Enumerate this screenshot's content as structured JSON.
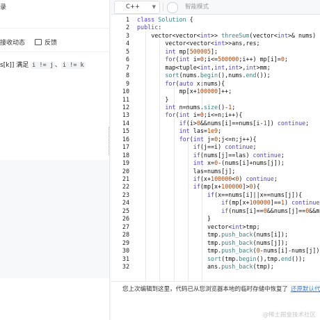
{
  "left_panel": {
    "title_fragment": "录",
    "tab_fragment": "接收动态",
    "feedback_label": "反馈",
    "statement_prefix": "s[k]] 满足",
    "statement_code1": "i != j",
    "statement_sep": "、",
    "statement_code2": "i != k"
  },
  "toolbar": {
    "language": "C++",
    "smart_mode_label": "智能模式"
  },
  "editor": {
    "lines": [
      {
        "n": "1",
        "indent": 0,
        "html": "<span class=\"kw\">class</span> <span class=\"ty\">Solution</span> {"
      },
      {
        "n": "2",
        "indent": 0,
        "html": "<span class=\"kw\">public</span>:"
      },
      {
        "n": "3",
        "indent": 1,
        "html": "vector&lt;vector&lt;<span class=\"kw\">int</span>&gt;&gt; <span class=\"fn\">threeSum</span>(vector&lt;<span class=\"kw\">int</span>&gt;&amp; nums)"
      },
      {
        "n": "4",
        "indent": 2,
        "html": "vector&lt;vector&lt;<span class=\"kw\">int</span>&gt;&gt;ans,res;"
      },
      {
        "n": "5",
        "indent": 2,
        "html": "<span class=\"kw\">int</span> mp[<span class=\"str\">500005</span>];"
      },
      {
        "n": "6",
        "indent": 2,
        "html": "<span class=\"kw\">for</span>(<span class=\"kw\">int</span> i=<span class=\"str\">0</span>;i&lt;=<span class=\"str\">500000</span>;i++) mp[i]=<span class=\"str\">0</span>;"
      },
      {
        "n": "7",
        "indent": 2,
        "html": "map&lt;tuple&lt;<span class=\"kw\">int</span>,<span class=\"kw\">int</span>,<span class=\"kw\">int</span>&gt;,<span class=\"kw\">int</span>&gt;mm;"
      },
      {
        "n": "8",
        "indent": 2,
        "html": "<span class=\"fn\">sort</span>(nums.<span class=\"fn\">begin</span>(),nums.<span class=\"fn\">end</span>());"
      },
      {
        "n": "9",
        "indent": 2,
        "html": "<span class=\"kw\">for</span>(<span class=\"kw\">auto</span> x:nums){"
      },
      {
        "n": "10",
        "indent": 3,
        "html": "mp[x+<span class=\"str\">100000</span>]++;"
      },
      {
        "n": "11",
        "indent": 2,
        "html": "}"
      },
      {
        "n": "12",
        "indent": 2,
        "html": "<span class=\"kw\">int</span> n=nums.<span class=\"fn\">size</span>()-<span class=\"str\">1</span>;"
      },
      {
        "n": "13",
        "indent": 2,
        "html": "<span class=\"kw\">for</span>(<span class=\"kw\">int</span> i=<span class=\"str\">0</span>;i&lt;=n;i++){"
      },
      {
        "n": "14",
        "indent": 3,
        "html": "<span class=\"kw\">if</span>(i&gt;<span class=\"str\">0</span>&amp;&amp;nums[i]==nums[i-<span class=\"str\">1</span>]) <span class=\"kw\">continue</span>;"
      },
      {
        "n": "15",
        "indent": 3,
        "html": "<span class=\"kw\">int</span> las=<span class=\"str\">1e9</span>;"
      },
      {
        "n": "16",
        "indent": 3,
        "html": "<span class=\"kw\">for</span>(<span class=\"kw\">int</span> j=<span class=\"str\">0</span>;j&lt;=n;j++){"
      },
      {
        "n": "17",
        "indent": 4,
        "html": "<span class=\"kw\">if</span>(j==i) <span class=\"kw\">continue</span>;"
      },
      {
        "n": "18",
        "indent": 4,
        "html": "<span class=\"kw\">if</span>(nums[j]==las) <span class=\"kw\">continue</span>;"
      },
      {
        "n": "19",
        "indent": 4,
        "html": "<span class=\"kw\">int</span> x=<span class=\"str\">0</span>-(nums[i]+nums[j]);"
      },
      {
        "n": "20",
        "indent": 4,
        "html": "las=nums[j];"
      },
      {
        "n": "21",
        "indent": 4,
        "html": "<span class=\"kw\">if</span>(x+<span class=\"str\">100000</span>&lt;<span class=\"str\">0</span>) <span class=\"kw\">continue</span>;"
      },
      {
        "n": "22",
        "indent": 4,
        "html": "<span class=\"kw\">if</span>(mp[x+<span class=\"str\">100000</span>]&gt;<span class=\"str\">0</span>){"
      },
      {
        "n": "23",
        "indent": 5,
        "html": "<span class=\"kw\">if</span>(x==nums[i]||x==nums[j]){"
      },
      {
        "n": "24",
        "indent": 6,
        "html": "<span class=\"kw\">if</span>(mp[x+<span class=\"str\">100000</span>]==<span class=\"str\">1</span>) <span class=\"kw\">continue</span>"
      },
      {
        "n": "25",
        "indent": 6,
        "html": "<span class=\"kw\">if</span>(nums[i]==<span class=\"str\">0</span>&amp;&amp;nums[j]==<span class=\"str\">0</span>&amp;&amp;m"
      },
      {
        "n": "26",
        "indent": 5,
        "html": "}"
      },
      {
        "n": "27",
        "indent": 5,
        "html": "vector&lt;<span class=\"kw\">int</span>&gt;tmp;"
      },
      {
        "n": "28",
        "indent": 5,
        "html": "tmp.<span class=\"fn\">push_back</span>(nums[i]);"
      },
      {
        "n": "29",
        "indent": 5,
        "html": "tmp.<span class=\"fn\">push_back</span>(nums[j]);"
      },
      {
        "n": "30",
        "indent": 5,
        "html": "tmp.<span class=\"fn\">push_back</span>(<span class=\"str\">0</span>-nums[i]-nums[j]);"
      },
      {
        "n": "31",
        "indent": 5,
        "html": "<span class=\"fn\">sort</span>(tmp.<span class=\"fn\">begin</span>(),tmp.<span class=\"fn\">end</span>());"
      },
      {
        "n": "32",
        "indent": 5,
        "html": "ans.<span class=\"fn\">push_back</span>(tmp);"
      }
    ]
  },
  "status": {
    "message": "您上次编辑到这里，代码已从您浏览器本地的临时存储中恢复了",
    "reset_link": "还原默认代"
  },
  "watermark": "@稀土掘金技术社区"
}
